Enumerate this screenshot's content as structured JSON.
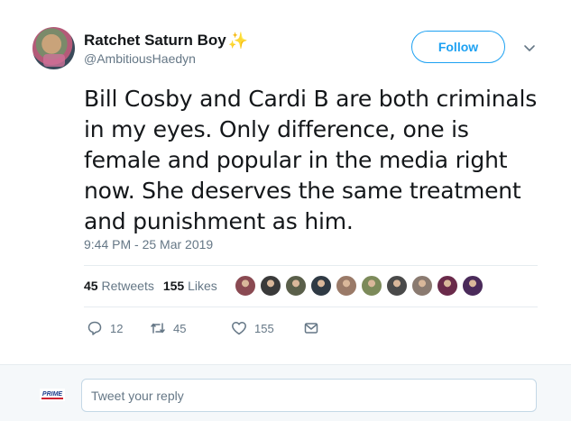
{
  "user": {
    "display_name": "Ratchet Saturn Boy",
    "emoji": "✨",
    "handle": "@AmbitiousHaedyn"
  },
  "follow_label": "Follow",
  "tweet": {
    "text": "Bill Cosby and Cardi B are both criminals in my eyes. Only difference, one is female and popular in the media right now. She deserves the same treatment and punishment as him.",
    "timestamp": "9:44 PM - 25 Mar 2019"
  },
  "stats": {
    "retweets_count": "45",
    "retweets_label": "Retweets",
    "likes_count": "155",
    "likes_label": "Likes"
  },
  "liker_avatar_colors": [
    "#8a4a52",
    "#3a3a3a",
    "#5a5f4a",
    "#2f3a44",
    "#9a7a68",
    "#7c8a5a",
    "#4a4a4a",
    "#8a7a70",
    "#6a2a4a",
    "#4a2a5a"
  ],
  "actions": {
    "reply_count": "12",
    "retweet_count": "45",
    "like_count": "155"
  },
  "reply_box": {
    "placeholder": "Tweet your reply",
    "avatar_text": "PRIME"
  },
  "colors": {
    "accent": "#1da1f2",
    "muted": "#657786"
  }
}
